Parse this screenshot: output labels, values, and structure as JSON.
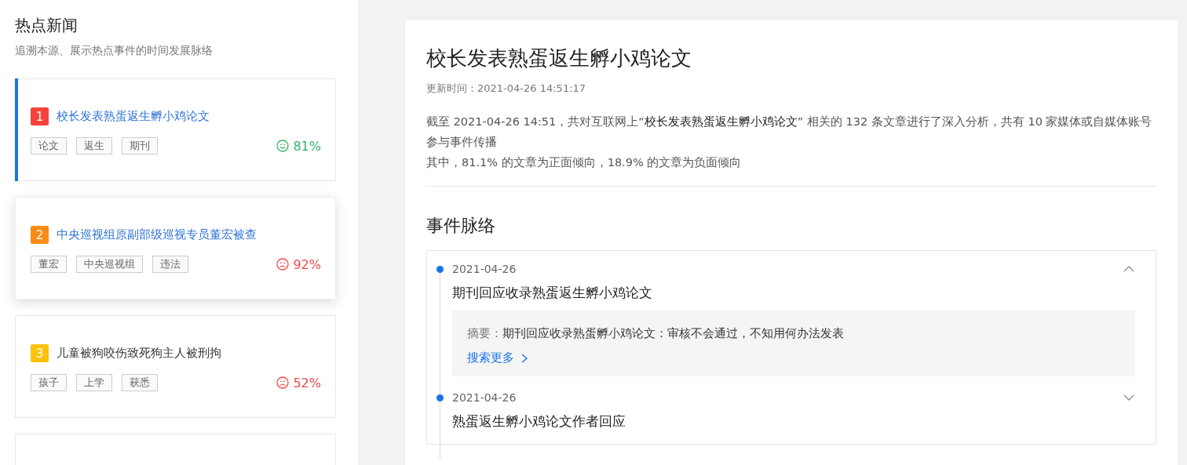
{
  "sidebar": {
    "title": "热点新闻",
    "subtitle": "追溯本源、展示热点事件的时间发展脉络",
    "items": [
      {
        "rank": "1",
        "color": "#f5433b",
        "title": "校长发表熟蛋返生孵小鸡论文",
        "tags": [
          "论文",
          "返生",
          "期刊"
        ],
        "kind": "positive",
        "percent": "81%",
        "selected": true,
        "hovered": false
      },
      {
        "rank": "2",
        "color": "#fa8c16",
        "title": "中央巡视组原副部级巡视专员董宏被查",
        "tags": [
          "董宏",
          "中央巡视组",
          "违法"
        ],
        "kind": "negative",
        "percent": "92%",
        "selected": false,
        "hovered": true
      },
      {
        "rank": "3",
        "color": "#fec20c",
        "title": "儿童被狗咬伤致死狗主人被刑拘",
        "tags": [
          "孩子",
          "上学",
          "获悉"
        ],
        "kind": "negative",
        "percent": "52%",
        "selected": false,
        "hovered": false
      }
    ]
  },
  "detail": {
    "title": "校长发表熟蛋返生孵小鸡论文",
    "updated": "更新时间：2021-04-26 14:51:17",
    "summary": [
      "截至 2021-04-26 14:51，共对互联网上“**校长发表熟蛋返生孵小鸡论文**” 相关的 132 条文章进行了深入分析，共有 10 家媒体或自媒体账号参与事件传播",
      "其中，81.1% 的文章为正面倾向，18.9% 的文章为负面倾向"
    ],
    "timeline_title": "事件脉络",
    "events": [
      {
        "date": "2021-04-26",
        "title": "期刊回应收录熟蛋返生孵小鸡论文",
        "expanded": true,
        "abstract_label": "摘要：",
        "abstract": "期刊回应收录熟蛋孵小鸡论文：审核不会通过，不知用何办法发表",
        "more": "搜索更多"
      },
      {
        "date": "2021-04-26",
        "title": "熟蛋返生孵小鸡论文作者回应",
        "expanded": false
      }
    ]
  }
}
